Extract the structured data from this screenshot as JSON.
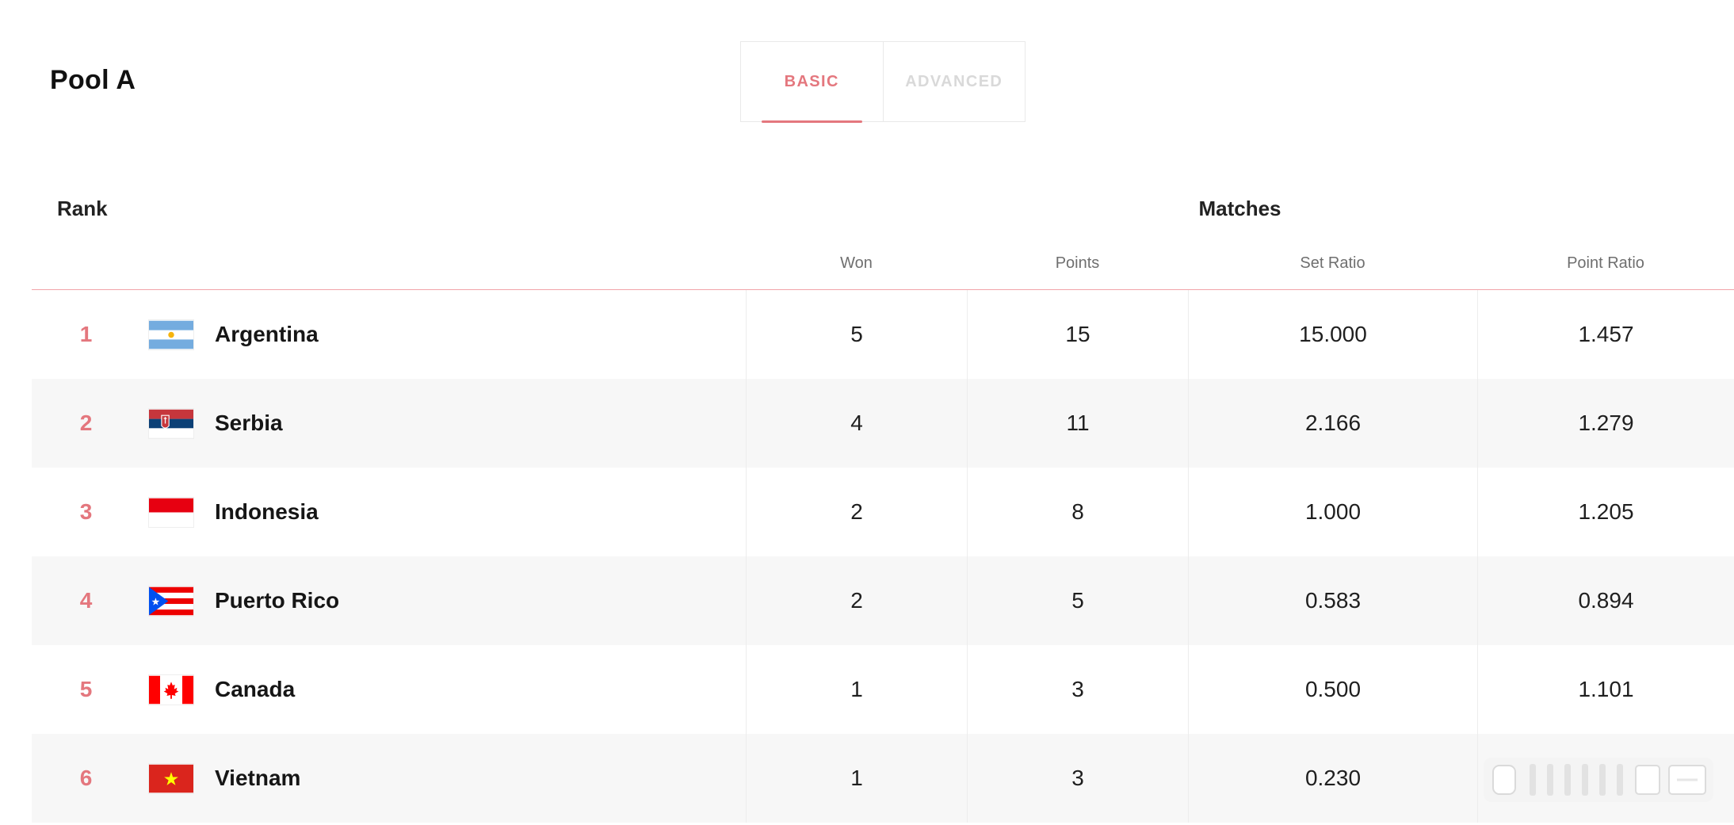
{
  "pool": {
    "title": "Pool A"
  },
  "tabs": [
    {
      "label": "BASIC",
      "active": true
    },
    {
      "label": "ADVANCED",
      "active": false
    }
  ],
  "table": {
    "rank_header": "Rank",
    "matches_header": "Matches",
    "columns": [
      "Won",
      "Points",
      "Set Ratio",
      "Point Ratio"
    ],
    "rows": [
      {
        "rank": "1",
        "flag_icon": "argentina-flag-icon",
        "team": "Argentina",
        "won": "5",
        "points": "15",
        "set_ratio": "15.000",
        "point_ratio": "1.457"
      },
      {
        "rank": "2",
        "flag_icon": "serbia-flag-icon",
        "team": "Serbia",
        "won": "4",
        "points": "11",
        "set_ratio": "2.166",
        "point_ratio": "1.279"
      },
      {
        "rank": "3",
        "flag_icon": "indonesia-flag-icon",
        "team": "Indonesia",
        "won": "2",
        "points": "8",
        "set_ratio": "1.000",
        "point_ratio": "1.205"
      },
      {
        "rank": "4",
        "flag_icon": "puerto-rico-flag-icon",
        "team": "Puerto Rico",
        "won": "2",
        "points": "5",
        "set_ratio": "0.583",
        "point_ratio": "0.894"
      },
      {
        "rank": "5",
        "flag_icon": "canada-flag-icon",
        "team": "Canada",
        "won": "1",
        "points": "3",
        "set_ratio": "0.500",
        "point_ratio": "1.101"
      },
      {
        "rank": "6",
        "flag_icon": "vietnam-flag-icon",
        "team": "Vietnam",
        "won": "1",
        "points": "3",
        "set_ratio": "0.230",
        "point_ratio": ""
      }
    ]
  },
  "colors": {
    "accent": "#e4777e",
    "header_rule": "#f2a3a8",
    "zebra": "#f7f7f7"
  }
}
